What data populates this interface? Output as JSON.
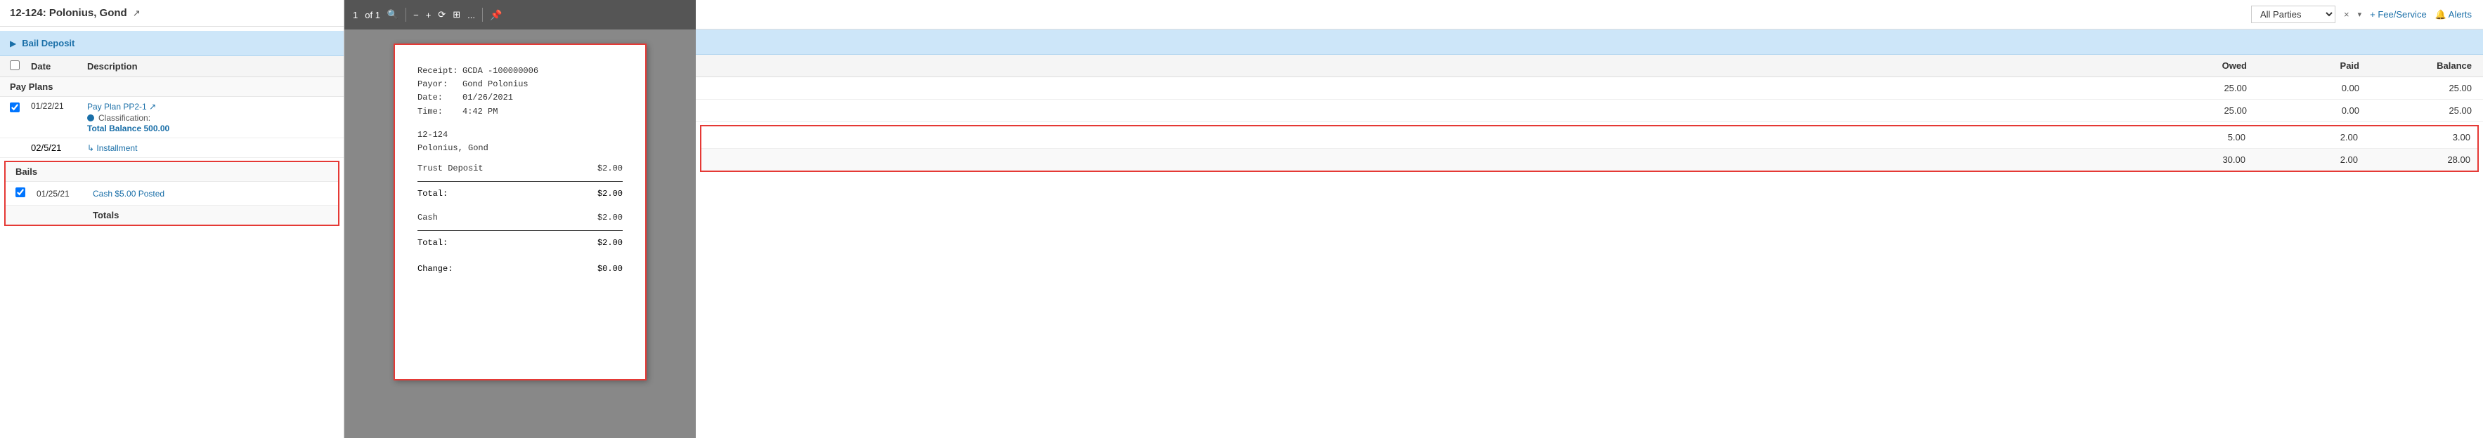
{
  "left_panel": {
    "title": "12-124: Polonius, Gond",
    "external_link_label": "↗",
    "bail_deposit_label": "Bail Deposit",
    "table_header": {
      "check": "",
      "date": "Date",
      "description": "Description"
    },
    "pay_plans_label": "Pay Plans",
    "pay_plan_row": {
      "date": "01/22/21",
      "link": "Pay Plan PP2-1",
      "link_external": "↗",
      "classification_label": "Classification:",
      "total_balance": "Total Balance 500.00"
    },
    "installment_row": {
      "date": "02/5/21",
      "label": "↳ Installment"
    },
    "bails_label": "Bails",
    "bails_row": {
      "date": "01/25/21",
      "description": "Cash $5.00 Posted"
    },
    "totals_label": "Totals"
  },
  "middle_panel": {
    "toolbar": {
      "page_number": "1",
      "of_label": "of 1",
      "search_icon": "🔍",
      "minus_icon": "−",
      "plus_icon": "+",
      "rotate_icon": "⟳",
      "view_icon": "⊞",
      "more_icon": "...",
      "pin_icon": "📌"
    },
    "receipt": {
      "receipt_label": "Receipt:",
      "receipt_value": "GCDA -100000006",
      "payor_label": "Payor:",
      "payor_value": "Gond Polonius",
      "date_label": "Date:",
      "date_value": "01/26/2021",
      "time_label": "Time:",
      "time_value": "4:42 PM",
      "case_line1": "12-124",
      "case_line2": "Polonius, Gond",
      "trust_deposit_label": "Trust Deposit",
      "trust_deposit_value": "$2.00",
      "total1_label": "Total:",
      "total1_value": "$2.00",
      "cash_label": "Cash",
      "cash_value": "$2.00",
      "total2_label": "Total:",
      "total2_value": "$2.00",
      "change_label": "Change:",
      "change_value": "$0.00"
    }
  },
  "right_panel": {
    "toolbar": {
      "all_parties_label": "All Parties",
      "x_label": "×",
      "dropdown_label": "▾",
      "fee_service_label": "+ Fee/Service",
      "alerts_label": "🔔 Alerts"
    },
    "table_header": {
      "owed": "Owed",
      "paid": "Paid",
      "balance": "Balance"
    },
    "pay_plan_row": {
      "owed": "25.00",
      "paid": "0.00",
      "balance": "25.00"
    },
    "installment_row": {
      "owed": "25.00",
      "paid": "0.00",
      "balance": "25.00"
    },
    "bails_row": {
      "owed": "5.00",
      "paid": "2.00",
      "balance": "3.00"
    },
    "totals_row": {
      "owed": "30.00",
      "paid": "2.00",
      "balance": "28.00"
    }
  }
}
